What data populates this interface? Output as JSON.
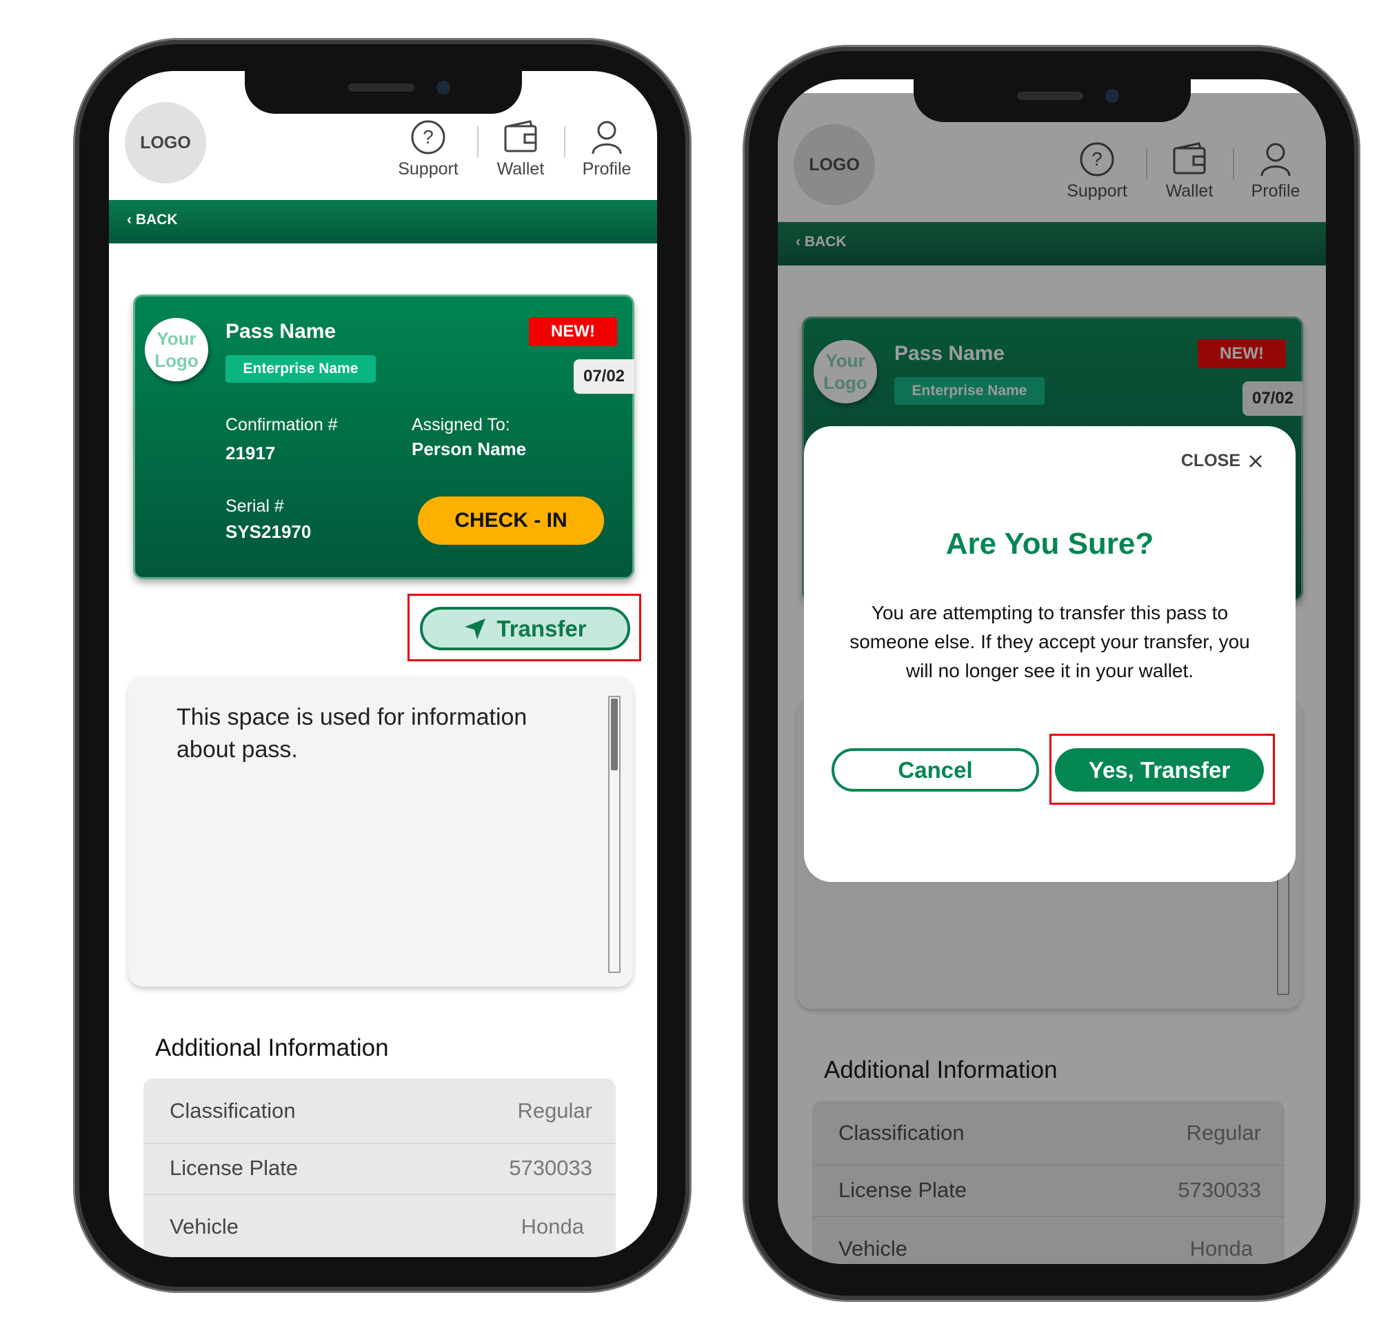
{
  "header": {
    "logo": "LOGO",
    "nav": [
      {
        "label": "Support",
        "icon": "help-circle-icon"
      },
      {
        "label": "Wallet",
        "icon": "wallet-icon"
      },
      {
        "label": "Profile",
        "icon": "user-icon"
      }
    ]
  },
  "back_label": "BACK",
  "pass": {
    "logo_line1": "Your",
    "logo_line2": "Logo",
    "name": "Pass Name",
    "enterprise": "Enterprise Name",
    "badge": "NEW!",
    "date": "07/02",
    "confirmation_label": "Confirmation #",
    "confirmation": "21917",
    "assigned_label": "Assigned To:",
    "assigned": "Person Name",
    "serial_label": "Serial #",
    "serial": "SYS21970",
    "checkin_label": "CHECK - IN"
  },
  "transfer_label": "Transfer",
  "info_text": "This space is used for information about pass.",
  "additional": {
    "title": "Additional Information",
    "rows": [
      {
        "k": "Classification",
        "v": "Regular"
      },
      {
        "k": "License Plate",
        "v": "5730033"
      },
      {
        "k": "Vehicle",
        "v": "Honda"
      }
    ]
  },
  "modal": {
    "close_label": "CLOSE",
    "title": "Are You Sure?",
    "body": "You are attempting to transfer this pass to someone else. If they accept your transfer, you will no longer see it in your wallet.",
    "cancel_label": "Cancel",
    "confirm_label": "Yes, Transfer"
  },
  "colors": {
    "brand_green": "#048652",
    "checkin": "#fdb000",
    "new_badge": "#f20000",
    "highlight": "#e8000b"
  }
}
